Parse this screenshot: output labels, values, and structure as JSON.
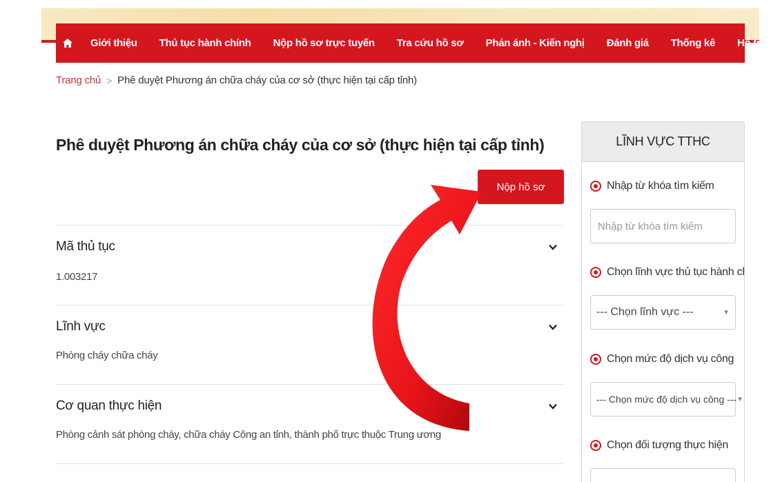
{
  "nav": {
    "home_icon": "home-icon",
    "items": [
      {
        "label": "Giới thiệu"
      },
      {
        "label": "Thủ tục hành chính"
      },
      {
        "label": "Nộp hồ sơ trực tuyến"
      },
      {
        "label": "Tra cứu hồ sơ"
      },
      {
        "label": "Phản ánh - Kiến nghị"
      },
      {
        "label": "Đánh giá"
      },
      {
        "label": "Thống kê"
      },
      {
        "label": "Hỗ trợ"
      }
    ]
  },
  "breadcrumb": {
    "home": "Trang chủ",
    "separator": ">",
    "current": "Phê duyệt Phương án chữa cháy của cơ sở (thực hiện tại cấp tỉnh)"
  },
  "page": {
    "title": "Phê duyệt Phương án chữa cháy của cơ sở (thực hiện tại cấp tỉnh)",
    "submit_button": "Nộp hồ sơ"
  },
  "sections": [
    {
      "title": "Mã thủ tục",
      "value": "1.003217"
    },
    {
      "title": "Lĩnh vực",
      "value": "Phòng cháy chữa cháy"
    },
    {
      "title": "Cơ quan thực hiện",
      "value": "Phòng cảnh sát phòng cháy, chữa cháy Công an tỉnh, thành phố trực thuộc Trung ương"
    }
  ],
  "sidebar": {
    "title": "LĨNH VỰC TTHC",
    "keyword_label": "Nhập từ khóa tìm kiếm",
    "keyword_placeholder": "Nhập từ khóa tìm kiếm",
    "field_label": "Chọn lĩnh vực thủ tục hành chính",
    "field_select": "--- Chọn lĩnh vực ---",
    "level_label": "Chọn mức độ dịch vụ công",
    "level_select": "--- Chọn mức độ dịch vụ công ---",
    "target_label": "Chọn đối tượng thực hiện"
  },
  "colors": {
    "brand_red": "#d4171f",
    "banner_gold": "#f3dfa8",
    "annotation_arrow": "#e8141a"
  }
}
